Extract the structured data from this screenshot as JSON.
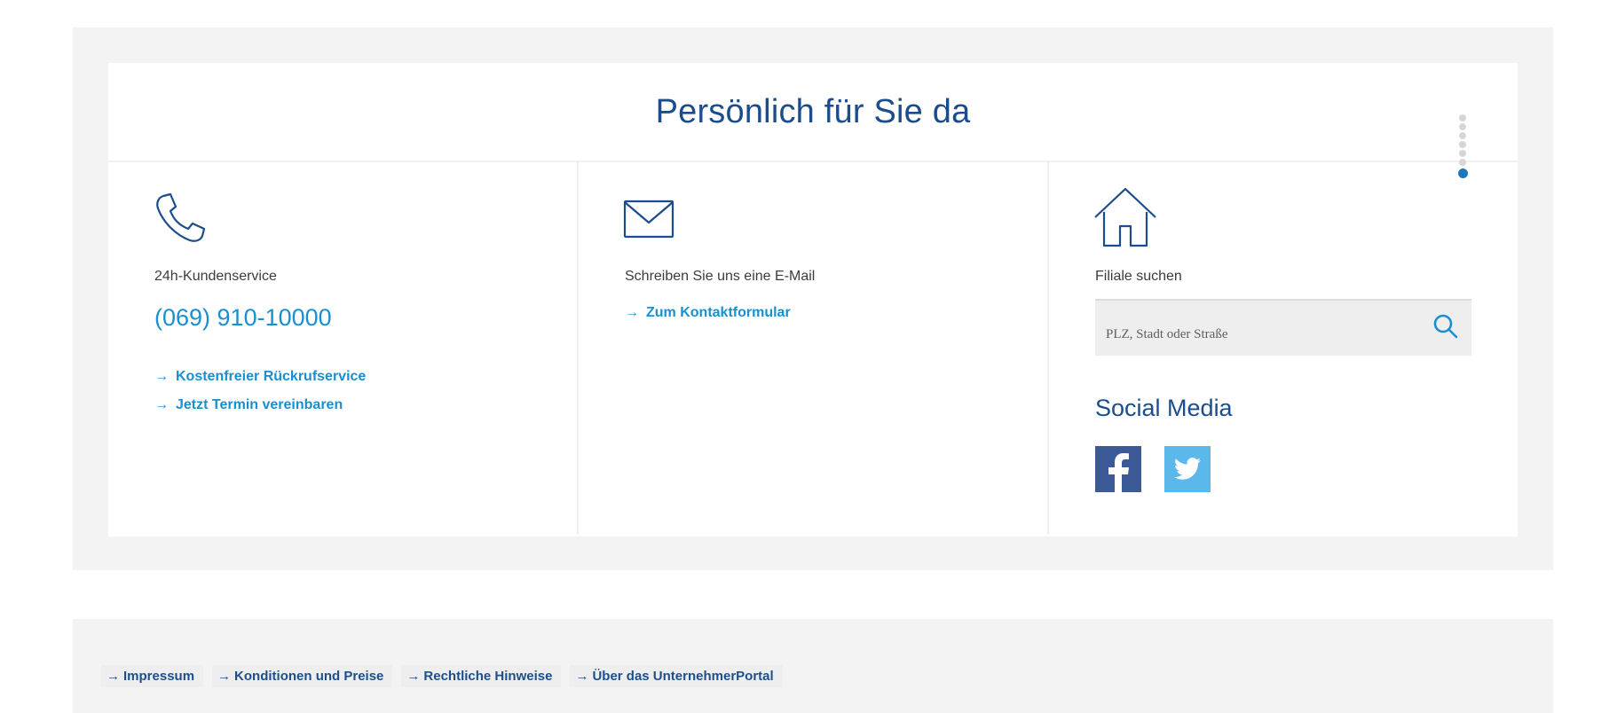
{
  "contact": {
    "title": "Persönlich für Sie da",
    "pager_count": 7,
    "phone": {
      "icon": "phone-icon",
      "label": "24h-Kundenservice",
      "number": "(069) 910-10000",
      "links": [
        "Kostenfreier Rückrufservice",
        "Jetzt Termin vereinbaren"
      ]
    },
    "email": {
      "icon": "envelope-icon",
      "label": "Schreiben Sie uns eine E-Mail",
      "link": "Zum Kontaktformular"
    },
    "branch": {
      "icon": "house-icon",
      "label": "Filiale suchen",
      "search_placeholder": "PLZ, Stadt oder Straße",
      "search_icon": "search-icon"
    },
    "social": {
      "title": "Social Media",
      "networks": [
        "facebook",
        "twitter"
      ]
    }
  },
  "footer": {
    "links": [
      "Impressum",
      "Konditionen und Preise",
      "Rechtliche Hinweise",
      "Über das UnternehmerPortal"
    ]
  },
  "colors": {
    "title_blue": "#1b4d8c",
    "link_blue": "#1a8fd0",
    "facebook": "#3b5a96",
    "twitter": "#5bb8ea",
    "background": "#f3f3f3"
  }
}
